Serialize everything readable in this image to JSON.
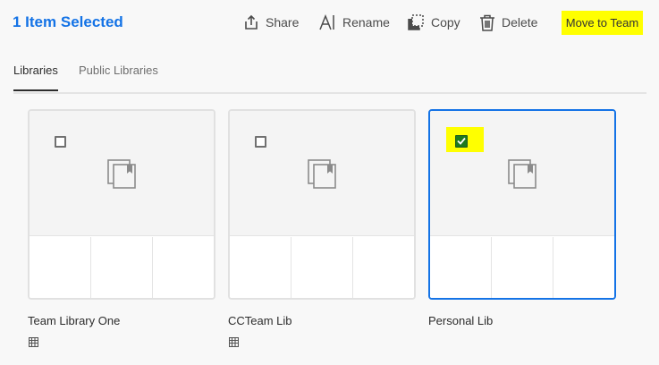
{
  "toolbar": {
    "selection_title": "1 Item Selected",
    "share_label": "Share",
    "rename_label": "Rename",
    "copy_label": "Copy",
    "delete_label": "Delete",
    "move_to_team_label": "Move to Team",
    "highlight_color": "#ffff00"
  },
  "tabs": [
    {
      "label": "Libraries",
      "active": true
    },
    {
      "label": "Public Libraries",
      "active": false
    }
  ],
  "libraries": [
    {
      "name": "Team Library One",
      "selected": false,
      "icon": "team-library-icon"
    },
    {
      "name": "CCTeam Lib",
      "selected": false,
      "icon": "team-library-icon"
    },
    {
      "name": "Personal Lib",
      "selected": true
    }
  ],
  "colors": {
    "accent": "#1473e6",
    "checkbox_checked": "#1e7a1e"
  }
}
